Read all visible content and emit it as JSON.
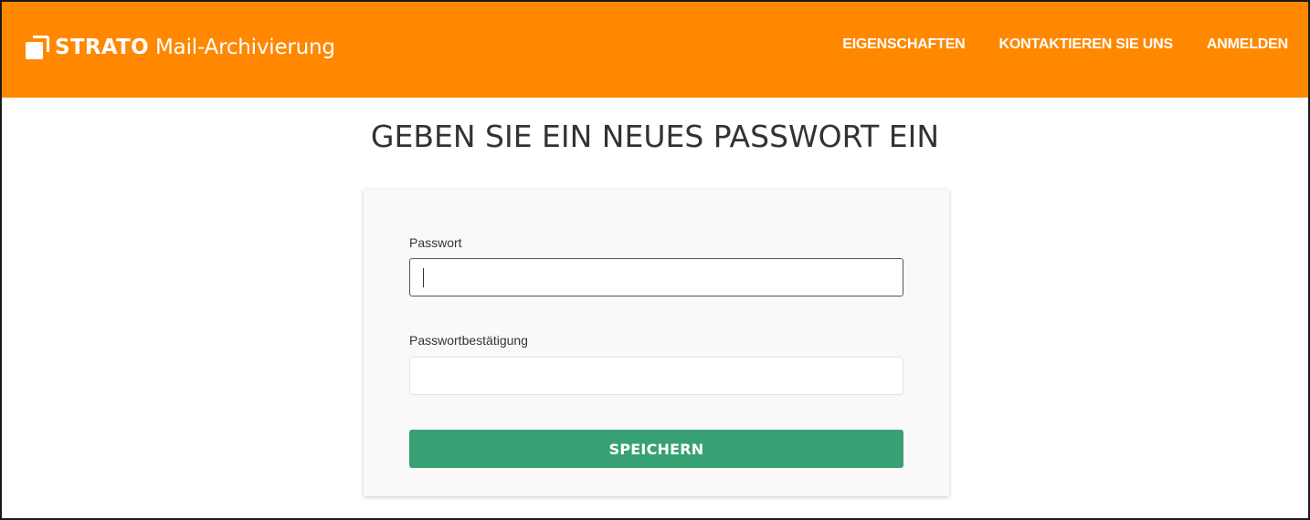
{
  "header": {
    "brand": "STRATO",
    "product": "Mail-Archivierung",
    "logo_icon": "strato-logo-icon",
    "background_color": "#ff8800",
    "nav": [
      {
        "label": "EIGENSCHAFTEN"
      },
      {
        "label": "KONTAKTIEREN SIE UNS"
      },
      {
        "label": "ANMELDEN"
      }
    ]
  },
  "main": {
    "title": "GEBEN SIE EIN NEUES PASSWORT EIN",
    "form": {
      "password_label": "Passwort",
      "password_value": "",
      "confirm_label": "Passwortbestätigung",
      "confirm_value": "",
      "save_label": "SPEICHERN",
      "save_color": "#38a174"
    }
  }
}
